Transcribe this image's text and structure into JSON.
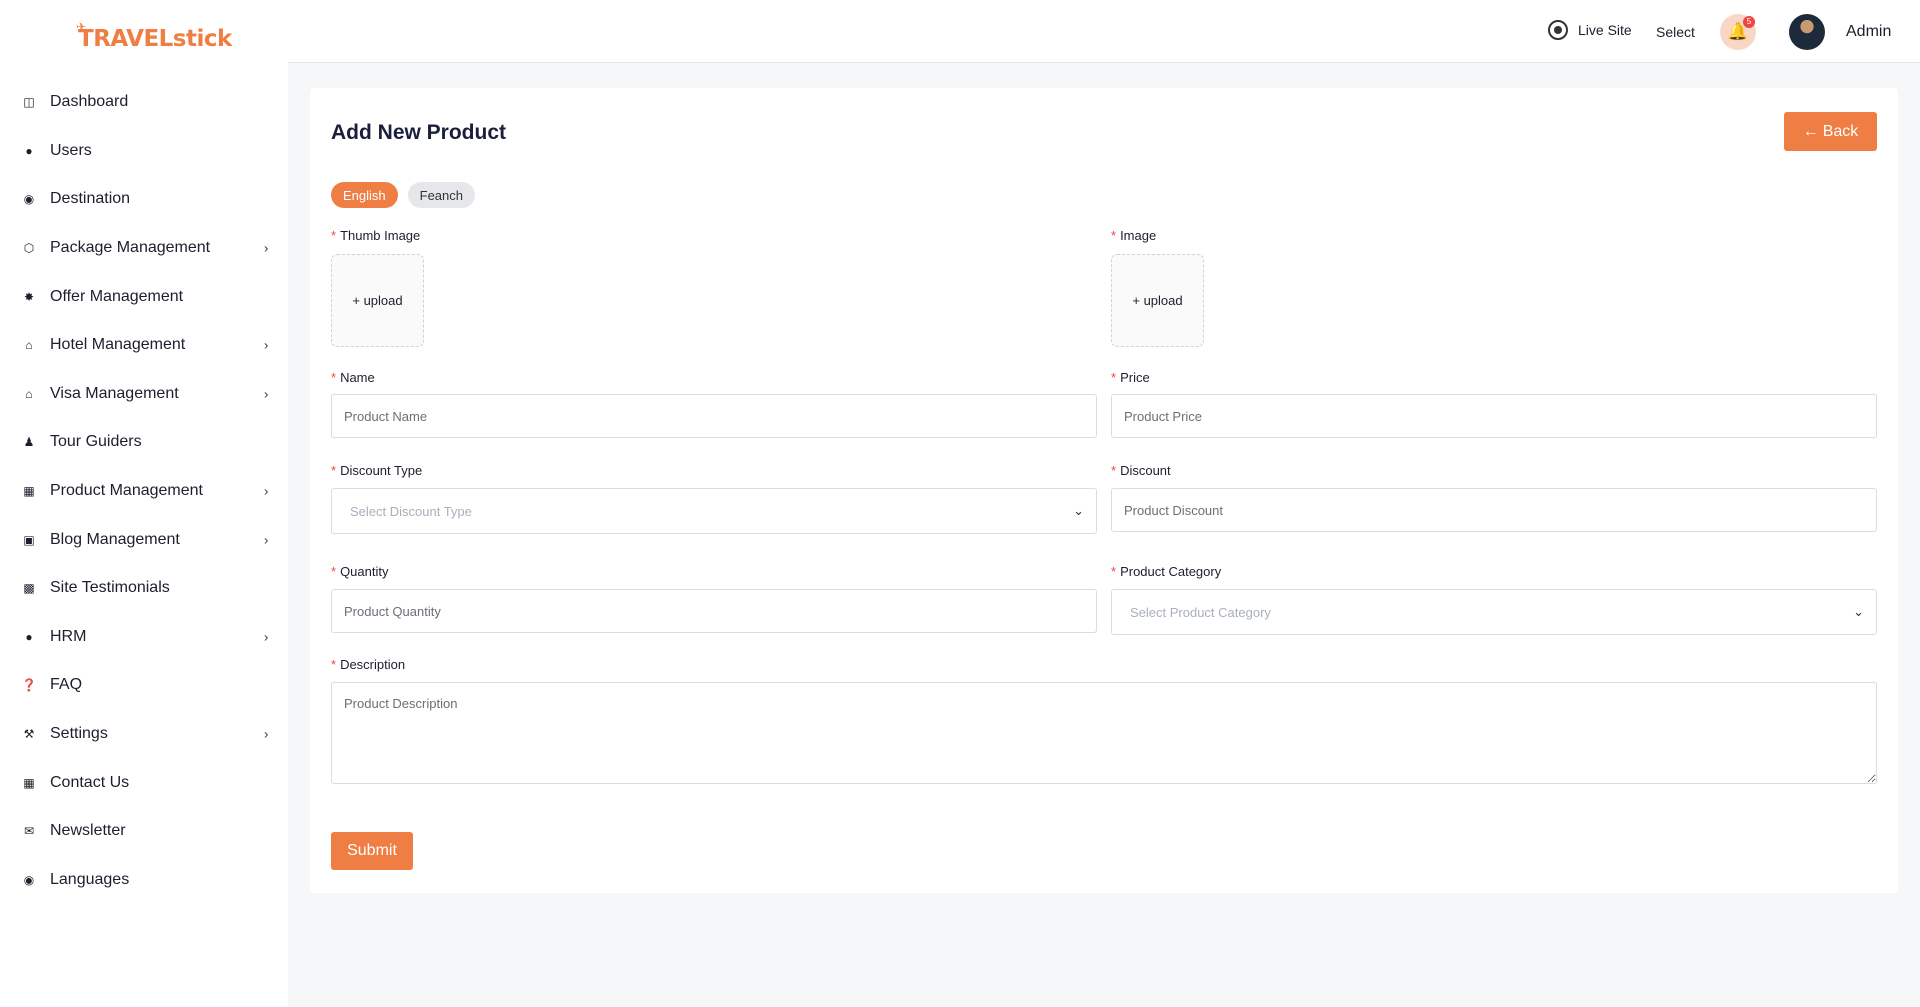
{
  "brand": {
    "name": "TRAVELstick",
    "color": "#ef7e44"
  },
  "sidebar": {
    "items": [
      {
        "label": "Dashboard",
        "icon": "dashboard-icon",
        "has_submenu": false
      },
      {
        "label": "Users",
        "icon": "users-icon",
        "has_submenu": false
      },
      {
        "label": "Destination",
        "icon": "location-pin-icon",
        "has_submenu": false
      },
      {
        "label": "Package Management",
        "icon": "cube-icon",
        "has_submenu": true
      },
      {
        "label": "Offer Management",
        "icon": "offer-badge-icon",
        "has_submenu": false
      },
      {
        "label": "Hotel Management",
        "icon": "hotel-icon",
        "has_submenu": true
      },
      {
        "label": "Visa Management",
        "icon": "visa-icon",
        "has_submenu": true
      },
      {
        "label": "Tour Guiders",
        "icon": "guide-person-icon",
        "has_submenu": false
      },
      {
        "label": "Product Management",
        "icon": "grid-icon",
        "has_submenu": true
      },
      {
        "label": "Blog Management",
        "icon": "blog-icon",
        "has_submenu": true
      },
      {
        "label": "Site Testimonials",
        "icon": "comment-icon",
        "has_submenu": false
      },
      {
        "label": "HRM",
        "icon": "team-icon",
        "has_submenu": true
      },
      {
        "label": "FAQ",
        "icon": "question-icon",
        "has_submenu": false
      },
      {
        "label": "Settings",
        "icon": "wrench-icon",
        "has_submenu": true
      },
      {
        "label": "Contact Us",
        "icon": "contact-card-icon",
        "has_submenu": false
      },
      {
        "label": "Newsletter",
        "icon": "mail-icon",
        "has_submenu": false
      },
      {
        "label": "Languages",
        "icon": "globe-icon",
        "has_submenu": false
      }
    ]
  },
  "header": {
    "live_site_label": "Live Site",
    "select_label": "Select",
    "notification_count": "5",
    "user_name": "Admin"
  },
  "form": {
    "title": "Add New Product",
    "back_label": "Back",
    "languages": [
      {
        "label": "English",
        "active": true
      },
      {
        "label": "Feanch",
        "active": false
      }
    ],
    "thumb_image_label": "Thumb Image",
    "image_label": "Image",
    "upload_label": "+ upload",
    "name_label": "Name",
    "name_placeholder": "Product Name",
    "price_label": "Price",
    "price_placeholder": "Product Price",
    "discount_type_label": "Discount Type",
    "discount_type_placeholder": "Select Discount Type",
    "discount_label": "Discount",
    "discount_placeholder": "Product Discount",
    "quantity_label": "Quantity",
    "quantity_placeholder": "Product Quantity",
    "category_label": "Product Category",
    "category_placeholder": "Select Product Category",
    "description_label": "Description",
    "description_placeholder": "Product Description",
    "required_mark": "*",
    "submit_label": "Submit"
  }
}
